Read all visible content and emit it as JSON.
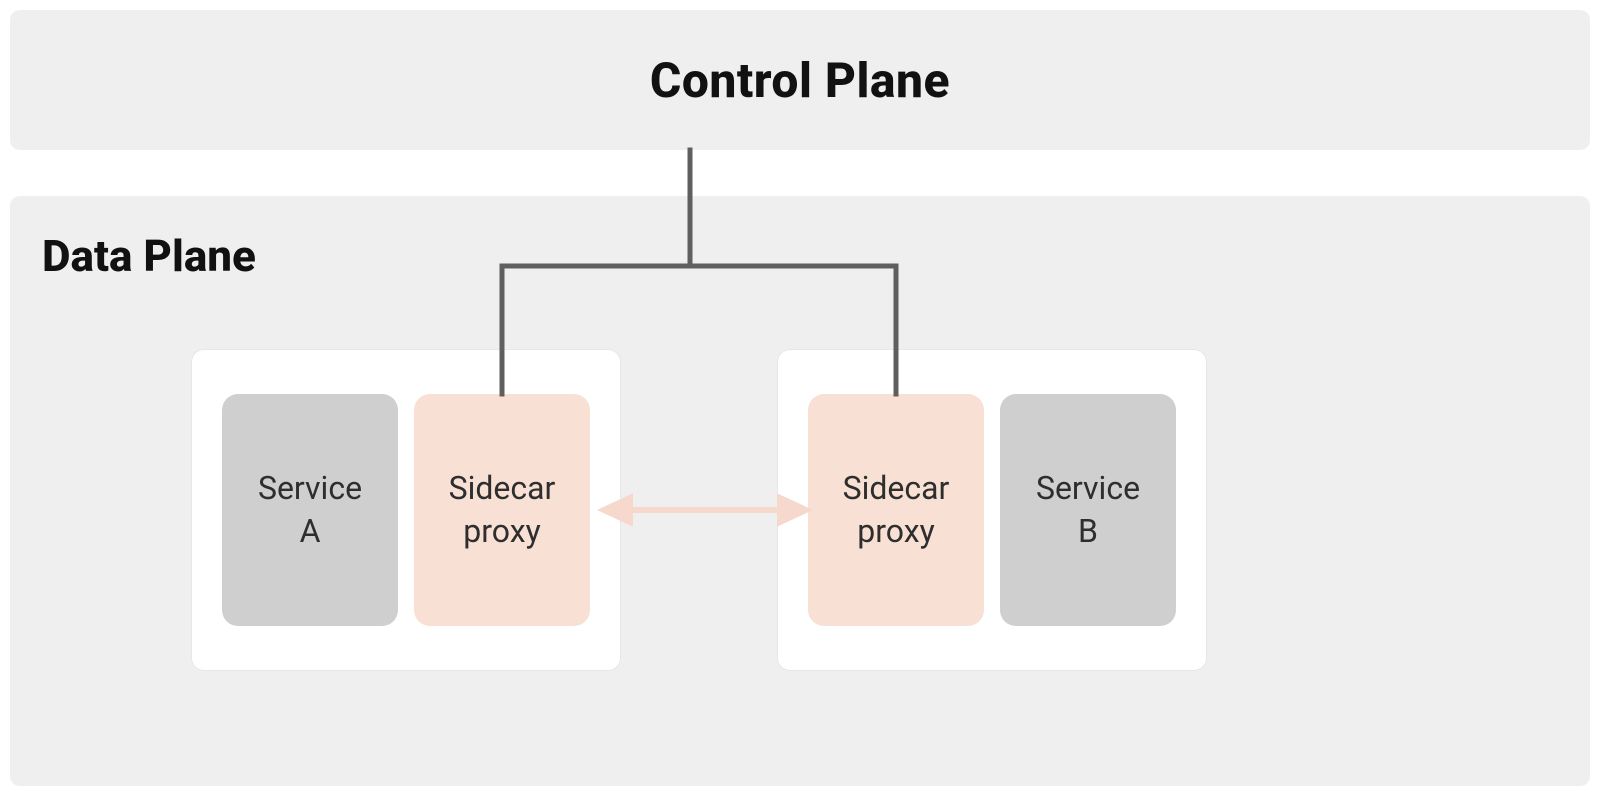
{
  "control_plane": {
    "title": "Control Plane"
  },
  "data_plane": {
    "title": "Data Plane",
    "pods": [
      {
        "service_label": "Service\nA",
        "proxy_label": "Sidecar\nproxy"
      },
      {
        "service_label": "Service\nB",
        "proxy_label": "Sidecar\nproxy"
      }
    ]
  },
  "colors": {
    "panel_bg": "#efefef",
    "service_bg": "#cfcfcf",
    "sidecar_bg": "#f8e1d4",
    "connector": "#5f5f5f",
    "data_arrow": "#f6d9cc"
  }
}
